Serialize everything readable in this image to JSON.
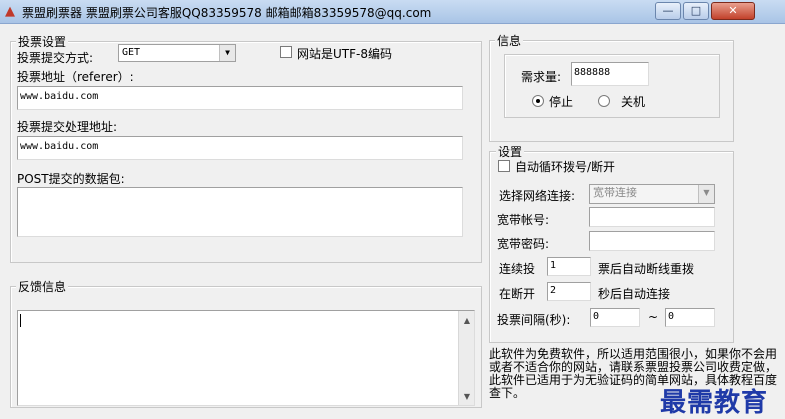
{
  "window": {
    "title": "票盟刷票器    票盟刷票公司客服QQ83359578    邮箱邮箱83359578@qq.com",
    "minimize_glyph": "—",
    "maximize_glyph": "□",
    "close_glyph": "✕",
    "app_icon": "app-icon"
  },
  "vote_settings": {
    "group_label": "投票设置",
    "method_label": "投票提交方式:",
    "method_value": "GET",
    "utf8_label": "网站是UTF-8编码",
    "utf8_checked": false,
    "referer_label": "投票地址（referer）:",
    "referer_value": "www.baidu.com",
    "handler_label": "投票提交处理地址:",
    "handler_value": "www.baidu.com",
    "post_label": "POST提交的数据包:",
    "post_value": ""
  },
  "feedback": {
    "group_label": "反馈信息",
    "content": ""
  },
  "info": {
    "group_label": "信息",
    "demand_label": "需求量:",
    "demand_value": "888888",
    "stop_label": "停止",
    "shutdown_label": "关机",
    "selected": "stop"
  },
  "settings": {
    "group_label": "设置",
    "auto_dial_label": "自动循环拨号/断开",
    "auto_dial_checked": false,
    "network_label": "选择网络连接:",
    "network_value": "宽带连接",
    "account_label": "宽带帐号:",
    "account_value": "",
    "password_label": "宽带密码:",
    "password_value": "",
    "consecutive_label": "连续投",
    "consecutive_value": "1",
    "consecutive_suffix": "票后自动断线重拨",
    "reconnect_label": "在断开",
    "reconnect_value": "2",
    "reconnect_suffix": "秒后自动连接",
    "interval_label": "投票间隔(秒):",
    "interval_min": "0",
    "interval_sep": "~",
    "interval_max": "0"
  },
  "notice": {
    "text": "此软件为免费软件，所以适用范围很小，如果你不会用或者不适合你的网站，请联系票盟投票公司收费定做，此软件已适用于为无验证码的简单网站，具体教程百度查下。"
  },
  "watermark": {
    "text": "最需教育"
  }
}
